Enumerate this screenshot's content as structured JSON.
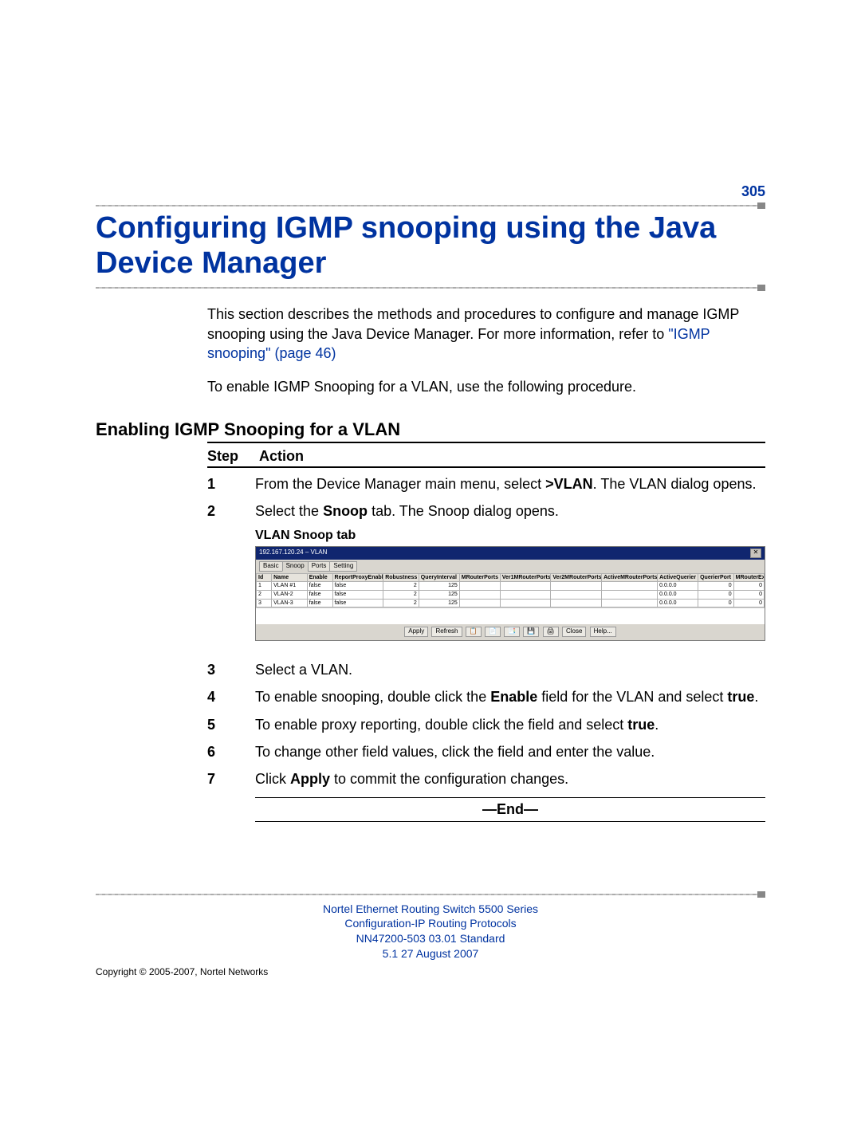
{
  "page_number": "305",
  "title": "Configuring IGMP snooping using the Java Device Manager",
  "intro": {
    "para1_a": "This section describes the methods and procedures to configure and manage IGMP snooping using the Java Device Manager.  For more information, refer to ",
    "link_text": "\"IGMP snooping\" (page 46)",
    "para2": "To enable IGMP Snooping for a VLAN, use the following procedure."
  },
  "section_heading": "Enabling IGMP Snooping for a VLAN",
  "step_header": {
    "step": "Step",
    "action": "Action"
  },
  "steps": {
    "s1": {
      "num": "1",
      "a": "From the Device Manager main menu, select ",
      "b": ">VLAN",
      "c": ". The VLAN dialog opens."
    },
    "s2": {
      "num": "2",
      "a": "Select the ",
      "b": "Snoop",
      "c": " tab.  The Snoop dialog opens."
    },
    "caption": "VLAN Snoop tab",
    "s3": {
      "num": "3",
      "a": "Select a VLAN."
    },
    "s4": {
      "num": "4",
      "a": "To enable snooping, double click the ",
      "b": "Enable",
      "c": " field for the VLAN and select ",
      "d": "true",
      "e": "."
    },
    "s5": {
      "num": "5",
      "a": "To enable proxy reporting, double click the field and select ",
      "b": "true",
      "c": "."
    },
    "s6": {
      "num": "6",
      "a": "To change other field values, click the field and enter the value."
    },
    "s7": {
      "num": "7",
      "a": "Click ",
      "b": "Apply",
      "c": " to commit the configuration changes."
    }
  },
  "end_label": "—End—",
  "screenshot": {
    "window_title": "192.167.120.24 – VLAN",
    "tabs": [
      "Basic",
      "Snoop",
      "Ports",
      "Setting"
    ],
    "columns": [
      "Id",
      "Name",
      "Enable",
      "ReportProxyEnable",
      "Robustness",
      "QueryInterval",
      "MRouterPorts",
      "Ver1MRouterPorts",
      "Ver2MRouterPorts",
      "ActiveMRouterPorts",
      "ActiveQuerier",
      "QuerierPort",
      "MRouterExpiration"
    ],
    "rows": [
      {
        "Id": "1",
        "Name": "VLAN #1",
        "Enable": "false",
        "ReportProxyEnable": "false",
        "Robustness": "2",
        "QueryInterval": "125",
        "MRouterPorts": "",
        "Ver1MRouterPorts": "",
        "Ver2MRouterPorts": "",
        "ActiveMRouterPorts": "",
        "ActiveQuerier": "0.0.0.0",
        "QuerierPort": "0",
        "MRouterExpiration": "0"
      },
      {
        "Id": "2",
        "Name": "VLAN-2",
        "Enable": "false",
        "ReportProxyEnable": "false",
        "Robustness": "2",
        "QueryInterval": "125",
        "MRouterPorts": "",
        "Ver1MRouterPorts": "",
        "Ver2MRouterPorts": "",
        "ActiveMRouterPorts": "",
        "ActiveQuerier": "0.0.0.0",
        "QuerierPort": "0",
        "MRouterExpiration": "0"
      },
      {
        "Id": "3",
        "Name": "VLAN-3",
        "Enable": "false",
        "ReportProxyEnable": "false",
        "Robustness": "2",
        "QueryInterval": "125",
        "MRouterPorts": "",
        "Ver1MRouterPorts": "",
        "Ver2MRouterPorts": "",
        "ActiveMRouterPorts": "",
        "ActiveQuerier": "0.0.0.0",
        "QuerierPort": "0",
        "MRouterExpiration": "0"
      }
    ],
    "toolbar": [
      "Apply",
      "Refresh",
      "📋",
      "📄",
      "📑",
      "💾",
      "🖨",
      "Close",
      "Help..."
    ]
  },
  "footer": {
    "l1": "Nortel Ethernet Routing Switch 5500 Series",
    "l2": "Configuration-IP Routing Protocols",
    "l3": "NN47200-503   03.01   Standard",
    "l4": "5.1   27 August 2007",
    "copyright": "Copyright © 2005-2007, Nortel Networks"
  }
}
